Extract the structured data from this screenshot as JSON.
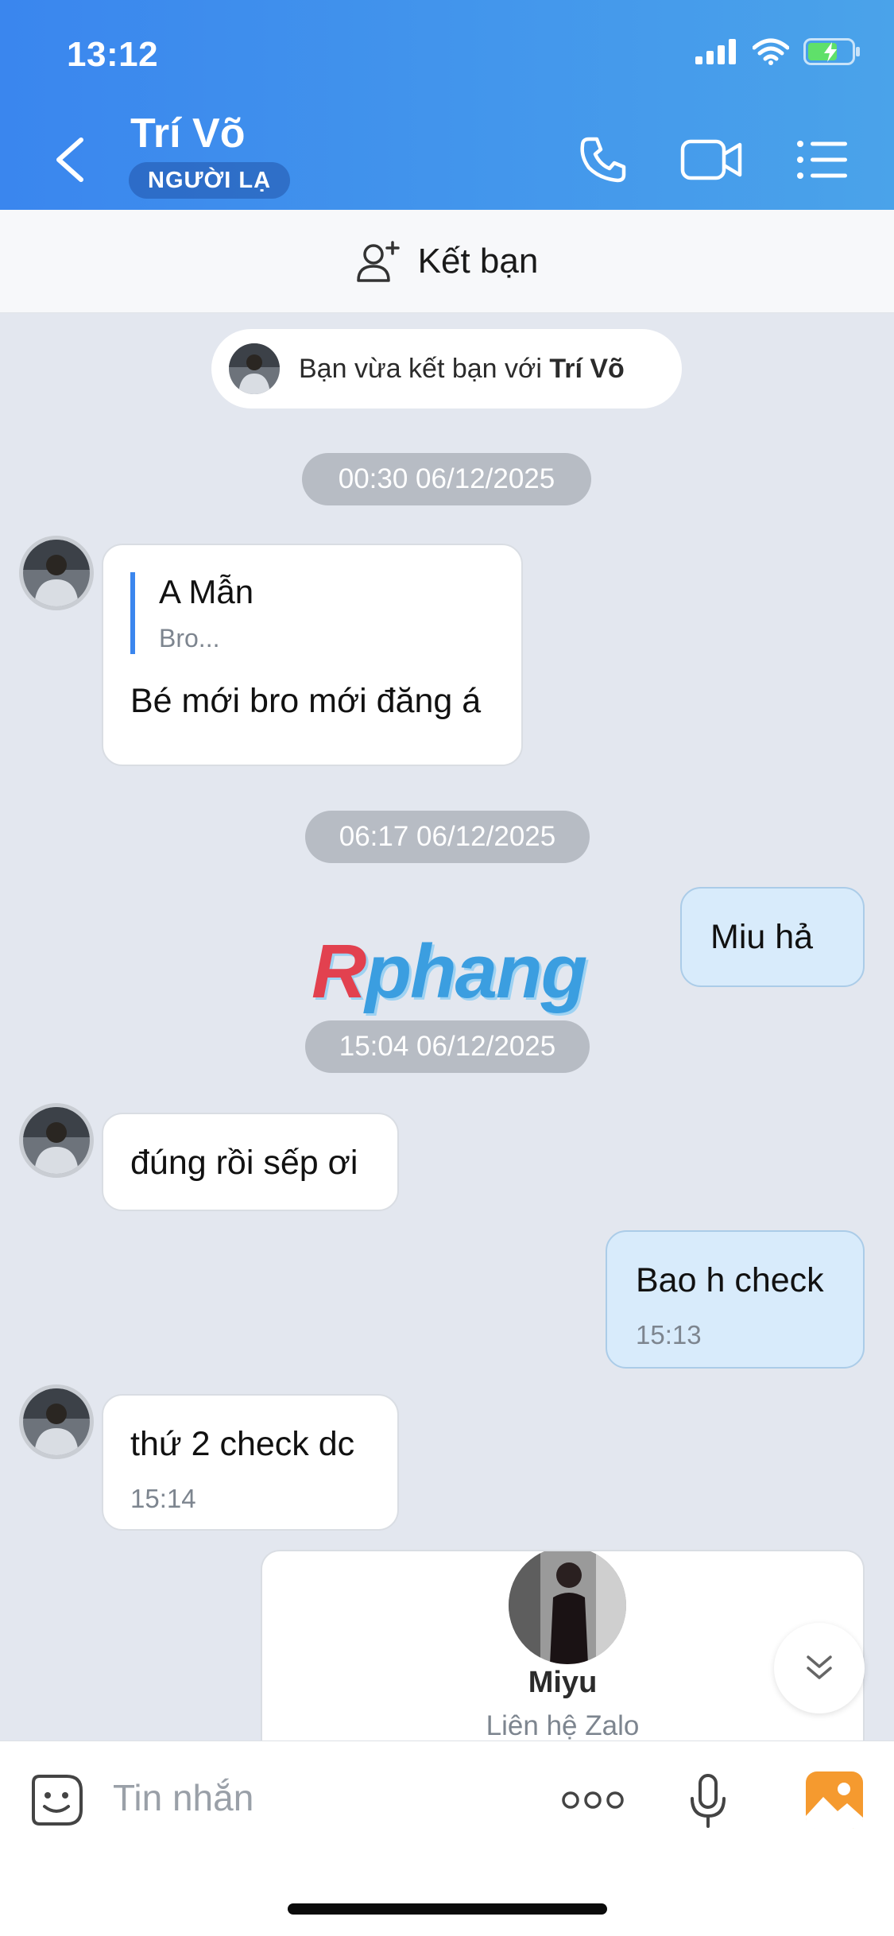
{
  "status_bar": {
    "time": "13:12"
  },
  "header": {
    "contact_name": "Trí Võ",
    "badge": "NGƯỜI LẠ"
  },
  "add_friend": {
    "label": "Kết bạn"
  },
  "notice": {
    "prefix": "Bạn vừa kết bạn với ",
    "name": "Trí Võ"
  },
  "timestamps": [
    "00:30 06/12/2025",
    "06:17 06/12/2025",
    "15:04 06/12/2025"
  ],
  "messages": {
    "m1": {
      "quote_name": "A Mẫn",
      "quote_text": "Bro...",
      "text": "Bé mới bro mới đăng á"
    },
    "m2": {
      "text": "Miu hả"
    },
    "m3": {
      "text": "đúng rồi sếp ơi"
    },
    "m4": {
      "text": "Bao h check",
      "time": "15:13"
    },
    "m5": {
      "text": "thứ 2 check dc",
      "time": "15:14"
    }
  },
  "contact_card": {
    "name": "Miyu",
    "subtitle": "Liên hệ Zalo"
  },
  "watermark": {
    "first": "R",
    "rest": "phang"
  },
  "composer": {
    "placeholder": "Tin nhắn"
  },
  "colors": {
    "header_start": "#3a86ee",
    "header_end": "#4aa3ea",
    "outgoing_bubble": "#d8ebfb",
    "chat_bg": "#e3e7ef"
  }
}
